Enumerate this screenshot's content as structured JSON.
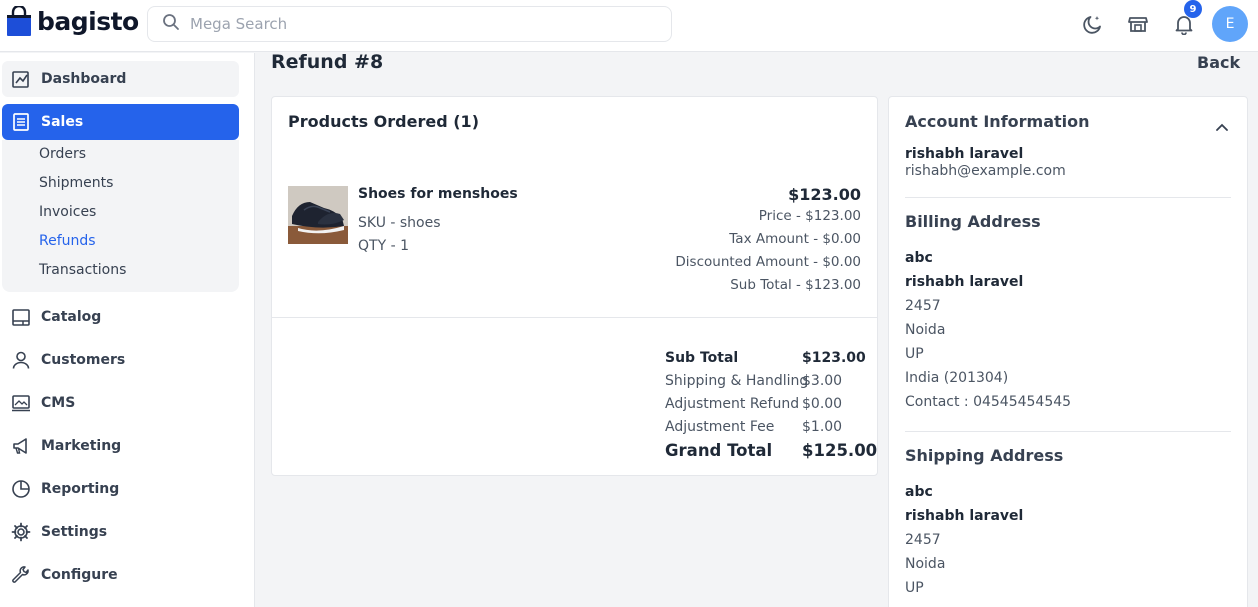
{
  "header": {
    "logo_text": "bagisto",
    "search_placeholder": "Mega Search",
    "notification_count": "9",
    "avatar_initial": "E"
  },
  "sidebar": {
    "items": [
      {
        "label": "Dashboard",
        "icon": "dashboard-icon"
      },
      {
        "label": "Sales",
        "icon": "sales-icon"
      },
      {
        "label": "Catalog",
        "icon": "catalog-icon"
      },
      {
        "label": "Customers",
        "icon": "customers-icon"
      },
      {
        "label": "CMS",
        "icon": "cms-icon"
      },
      {
        "label": "Marketing",
        "icon": "marketing-icon"
      },
      {
        "label": "Reporting",
        "icon": "reporting-icon"
      },
      {
        "label": "Settings",
        "icon": "settings-icon"
      },
      {
        "label": "Configure",
        "icon": "configure-icon"
      }
    ],
    "sales_sub": [
      "Orders",
      "Shipments",
      "Invoices",
      "Refunds",
      "Transactions"
    ]
  },
  "page": {
    "title": "Refund #8",
    "back_label": "Back"
  },
  "products": {
    "title": "Products Ordered (1)",
    "item": {
      "name": "Shoes for menshoes",
      "sku": "SKU - shoes",
      "qty": "QTY - 1",
      "price_main": "$123.00",
      "price": "Price - $123.00",
      "tax": "Tax Amount - $0.00",
      "discount": "Discounted Amount - $0.00",
      "subtotal": "Sub Total - $123.00"
    },
    "summary": [
      {
        "label": "Sub Total",
        "value": "$123.00"
      },
      {
        "label": "Shipping & Handling",
        "value": "$3.00"
      },
      {
        "label": "Adjustment Refund",
        "value": "$0.00"
      },
      {
        "label": "Adjustment Fee",
        "value": "$1.00"
      },
      {
        "label": "Grand Total",
        "value": "$125.00"
      }
    ]
  },
  "account": {
    "title": "Account Information",
    "name": "rishabh laravel",
    "email": "rishabh@example.com"
  },
  "billing": {
    "title": "Billing Address",
    "lines": [
      "abc",
      "rishabh laravel",
      "2457",
      "Noida",
      "UP",
      "India (201304)",
      "Contact : 04545454545"
    ]
  },
  "shipping": {
    "title": "Shipping Address",
    "lines": [
      "abc",
      "rishabh laravel",
      "2457",
      "Noida",
      "UP"
    ]
  },
  "colors": {
    "accent": "#2563eb",
    "avatar": "#60a5fa"
  }
}
